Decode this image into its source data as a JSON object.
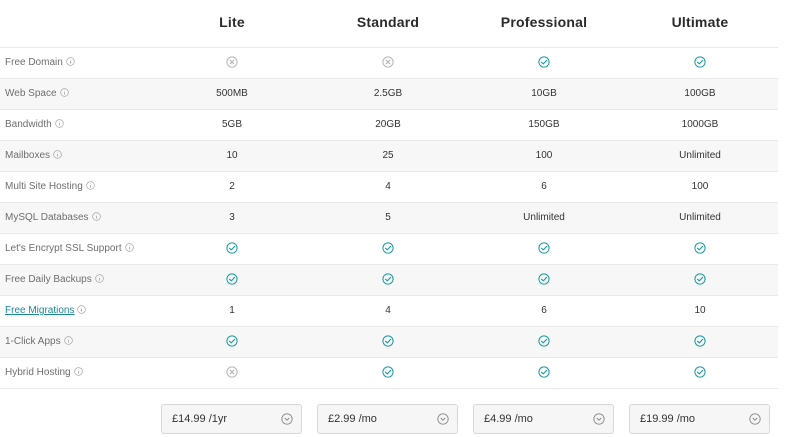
{
  "plans": [
    {
      "name": "Lite",
      "price": "£14.99 /1yr"
    },
    {
      "name": "Standard",
      "price": "£2.99 /mo"
    },
    {
      "name": "Professional",
      "price": "£4.99 /mo"
    },
    {
      "name": "Ultimate",
      "price": "£19.99 /mo"
    }
  ],
  "features": [
    {
      "label": "Free Domain",
      "values": [
        "cross-icon",
        "cross-icon",
        "check-icon",
        "check-icon"
      ]
    },
    {
      "label": "Web Space",
      "values": [
        "500MB",
        "2.5GB",
        "10GB",
        "100GB"
      ]
    },
    {
      "label": "Bandwidth",
      "values": [
        "5GB",
        "20GB",
        "150GB",
        "1000GB"
      ]
    },
    {
      "label": "Mailboxes",
      "values": [
        "10",
        "25",
        "100",
        "Unlimited"
      ]
    },
    {
      "label": "Multi Site Hosting",
      "values": [
        "2",
        "4",
        "6",
        "100"
      ]
    },
    {
      "label": "MySQL Databases",
      "values": [
        "3",
        "5",
        "Unlimited",
        "Unlimited"
      ]
    },
    {
      "label": "Let's Encrypt SSL Support",
      "values": [
        "check-icon",
        "check-icon",
        "check-icon",
        "check-icon"
      ]
    },
    {
      "label": "Free Daily Backups",
      "values": [
        "check-icon",
        "check-icon",
        "check-icon",
        "check-icon"
      ]
    },
    {
      "label": "Free Migrations",
      "link": true,
      "values": [
        "1",
        "4",
        "6",
        "10"
      ]
    },
    {
      "label": "1-Click Apps",
      "values": [
        "check-icon",
        "check-icon",
        "check-icon",
        "check-icon"
      ]
    },
    {
      "label": "Hybrid Hosting",
      "values": [
        "cross-icon",
        "check-icon",
        "check-icon",
        "check-icon"
      ]
    }
  ],
  "colors": {
    "check": "#1a9aa0",
    "cross": "#b5b5b5",
    "link": "#1a8a9a",
    "row_shade": "#f7f7f7"
  }
}
